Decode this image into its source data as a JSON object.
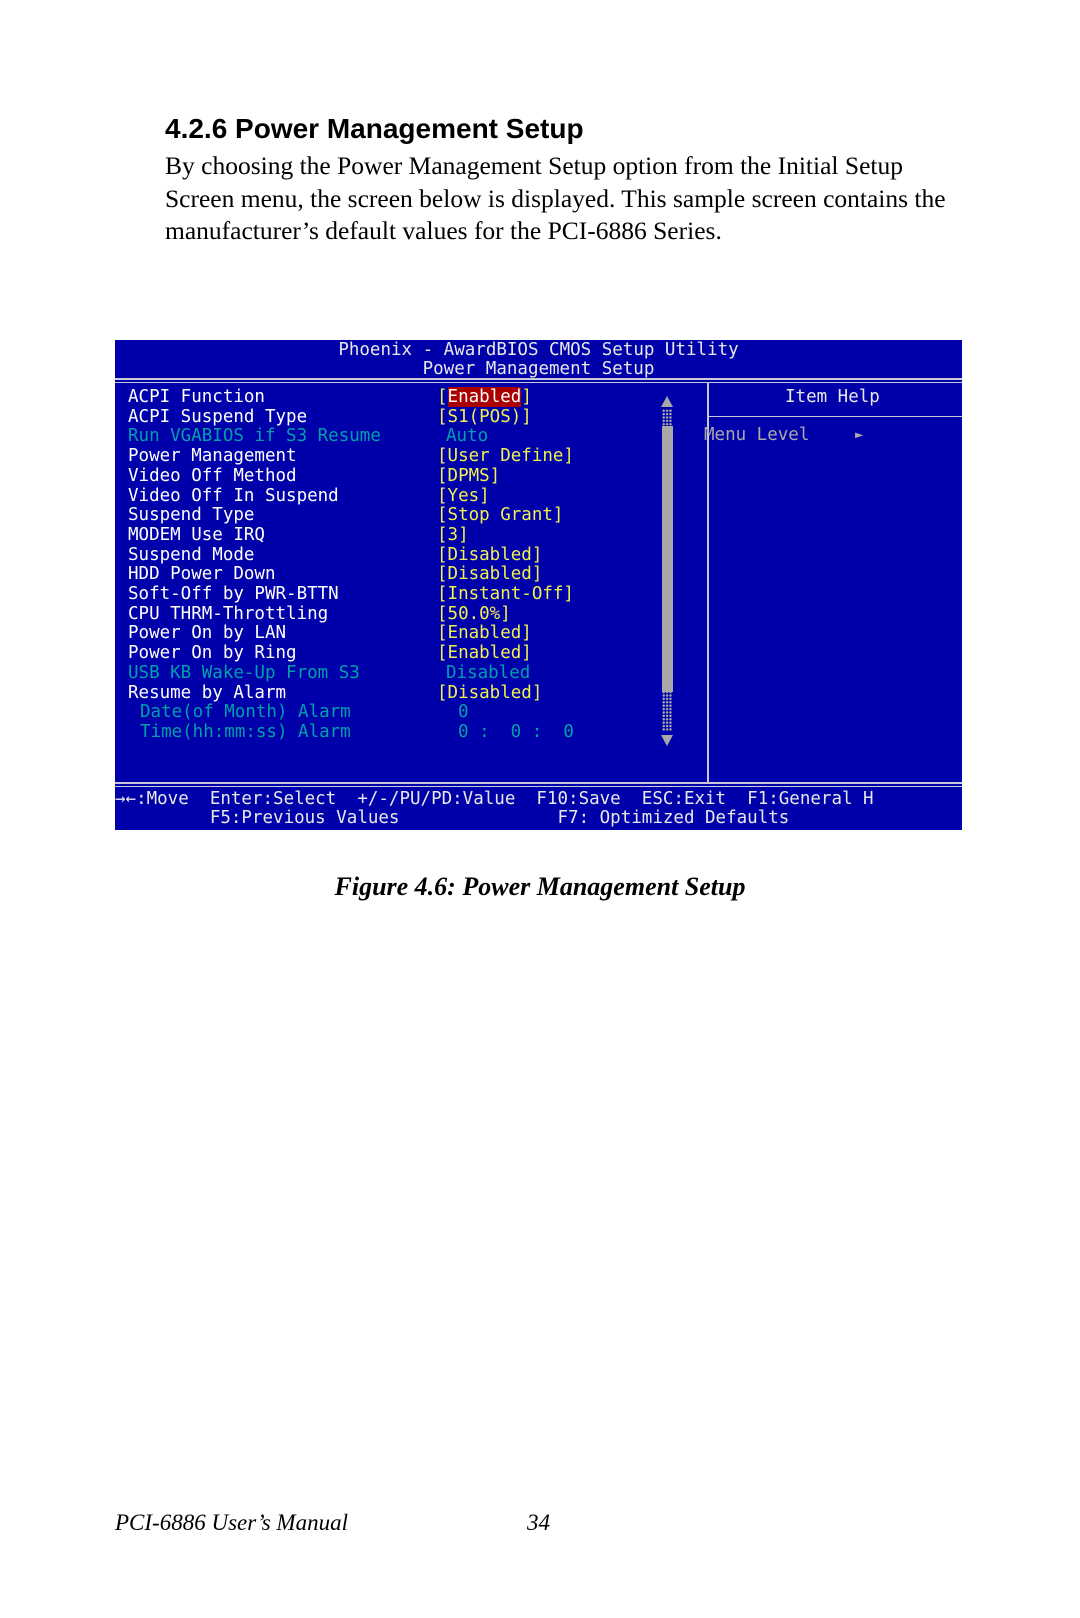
{
  "document": {
    "heading": "4.2.6 Power Management Setup",
    "intro": "By choosing the Power Management Setup option from the Initial Setup Screen menu, the screen below is displayed. This sample screen contains the manufacturer’s default values for the PCI-6886 Series.",
    "caption": "Figure 4.6: Power Management Setup",
    "footer_manual": "PCI-6886 User’s Manual",
    "page_number": "34"
  },
  "bios": {
    "title": "Phoenix - AwardBIOS CMOS Setup Utility",
    "subtitle": "Power Management Setup",
    "colors": {
      "background": "#0000aa",
      "label": "#ffffff",
      "value": "#f0f050",
      "disabled": "#00a0a8",
      "highlight": "#aa0000"
    },
    "items": [
      {
        "label": "ACPI Function",
        "value_open": "[",
        "value": "Enabled",
        "value_close": "]",
        "highlighted": true
      },
      {
        "label": "ACPI Suspend Type",
        "value": "[S1(POS)]"
      },
      {
        "label": "Run VGABIOS if S3 Resume",
        "value": "Auto",
        "disabled": true
      },
      {
        "label": "Power Management",
        "value": "[User Define]"
      },
      {
        "label": "Video Off Method",
        "value": "[DPMS]"
      },
      {
        "label": "Video Off In Suspend",
        "value": "[Yes]"
      },
      {
        "label": "Suspend Type",
        "value": "[Stop Grant]"
      },
      {
        "label": "MODEM Use IRQ",
        "value": "[3]"
      },
      {
        "label": "Suspend Mode",
        "value": "[Disabled]"
      },
      {
        "label": "HDD Power Down",
        "value": "[Disabled]"
      },
      {
        "label": "Soft-Off by PWR-BTTN",
        "value": "[Instant-Off]"
      },
      {
        "label": "CPU THRM-Throttling",
        "value": "[50.0%]"
      },
      {
        "label": "Power On by LAN",
        "value": "[Enabled]"
      },
      {
        "label": "Power On by Ring",
        "value": "[Enabled]"
      },
      {
        "label": "USB KB Wake-Up From S3",
        "value": "Disabled",
        "disabled": true
      },
      {
        "label": "Resume by Alarm",
        "value": "[Disabled]"
      },
      {
        "label": "Date(of Month) Alarm",
        "value": "0",
        "disabled": true
      },
      {
        "label": "Time(hh:mm:ss) Alarm",
        "value": "0 :  0 :  0",
        "disabled": true
      }
    ],
    "help": {
      "title": "Item Help",
      "text": "Menu Level",
      "arrow": "►"
    },
    "footer": {
      "line1": "→←:Move  Enter:Select  +/-/PU/PD:Value  F10:Save  ESC:Exit  F1:General H",
      "line2": "         F5:Previous Values               F7: Optimized Defaults"
    }
  }
}
